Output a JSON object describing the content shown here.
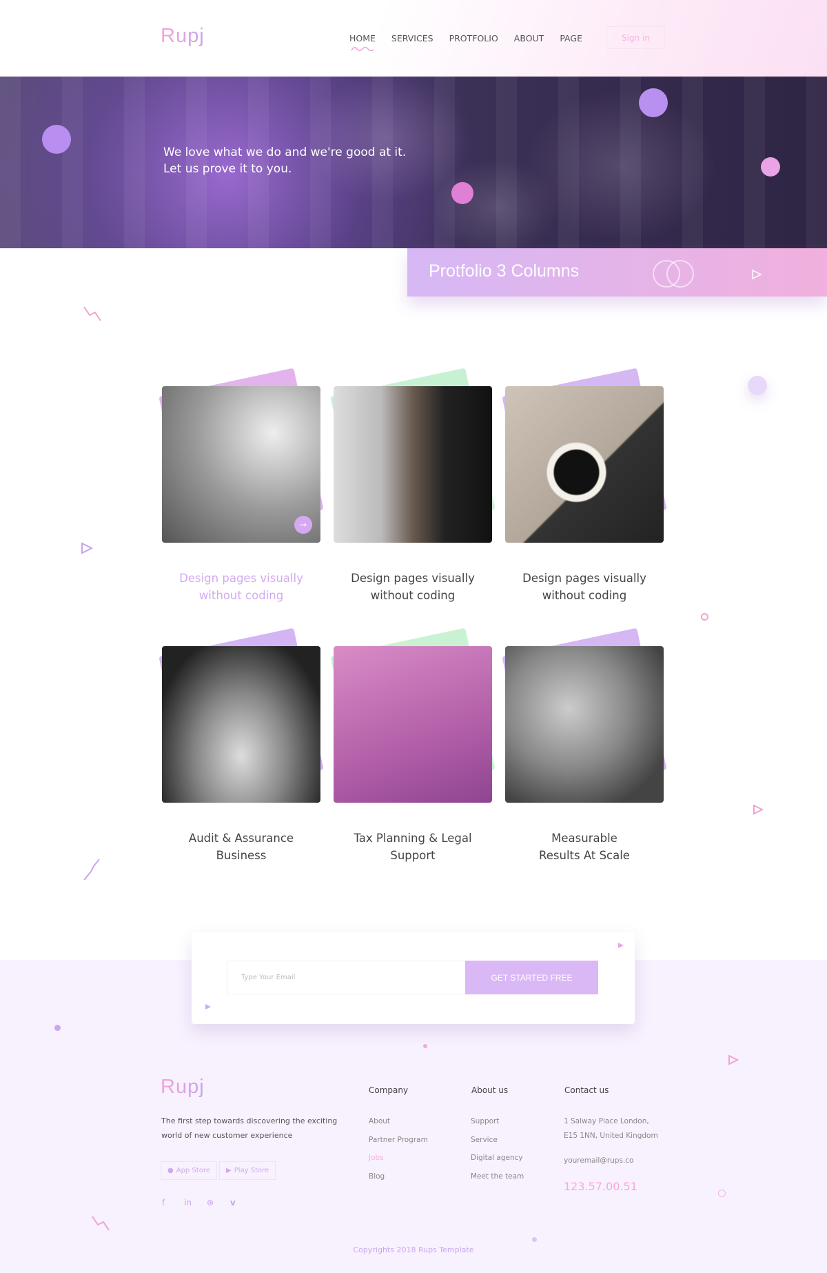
{
  "header": {
    "logo": "Rupj",
    "nav": [
      "HOME",
      "SERVICES",
      "PROTFOLIO",
      "ABOUT",
      "PAGE"
    ],
    "active": "HOME",
    "signin": "Sign in"
  },
  "hero": {
    "line1": "We love what we do and we're good at it.",
    "line2": "Let us prove it to you."
  },
  "banner": {
    "title": "Protfolio 3 Columns"
  },
  "portfolio": [
    {
      "title1": "Design pages visually",
      "title2": "without coding",
      "highlight": true,
      "accent": "#e3b3ee"
    },
    {
      "title1": "Design pages visually",
      "title2": "without coding",
      "accent": "#c7f1d3"
    },
    {
      "title1": "Design pages visually",
      "title2": "without coding",
      "accent": "#d5b7f3"
    },
    {
      "title1": "Audit & Assurance",
      "title2": "Business",
      "accent": "#d3b5f3"
    },
    {
      "title1": "Tax Planning & Legal",
      "title2": "Support",
      "accent": "#c9f2d2"
    },
    {
      "title1": "Measurable",
      "title2": "Results At Scale",
      "accent": "#d5b7f3"
    }
  ],
  "subscribe": {
    "placeholder": "Type Your Email",
    "button": "GET STARTED FREE"
  },
  "footer": {
    "logo": "Rupj",
    "tagline1": "The first step towards discovering the exciting",
    "tagline2": "world of new customer experience",
    "app_store": "App Store",
    "play_store": "Play Store",
    "socials": [
      "facebook-icon",
      "linkedin-icon",
      "dribbble-icon",
      "vimeo-icon"
    ],
    "company": {
      "heading": "Company",
      "links": [
        "About",
        "Partner Program",
        "Jobs",
        "Blog"
      ],
      "active": "Jobs"
    },
    "about": {
      "heading": "About us",
      "links": [
        "Support",
        "Service",
        "Digital agency",
        "Meet the team"
      ]
    },
    "contact": {
      "heading": "Contact us",
      "address1": "1 Salway Place London,",
      "address2": "E15 1NN, United Kingdom",
      "email": "youremail@rups.co",
      "phone": "123.57.00.51"
    },
    "copyright": "Copyrights 2018 Rups Template"
  },
  "colors": {
    "pink": "#f7a3d6",
    "lavender": "#d9b8f5",
    "footer_bg": "#f8f1fe"
  }
}
